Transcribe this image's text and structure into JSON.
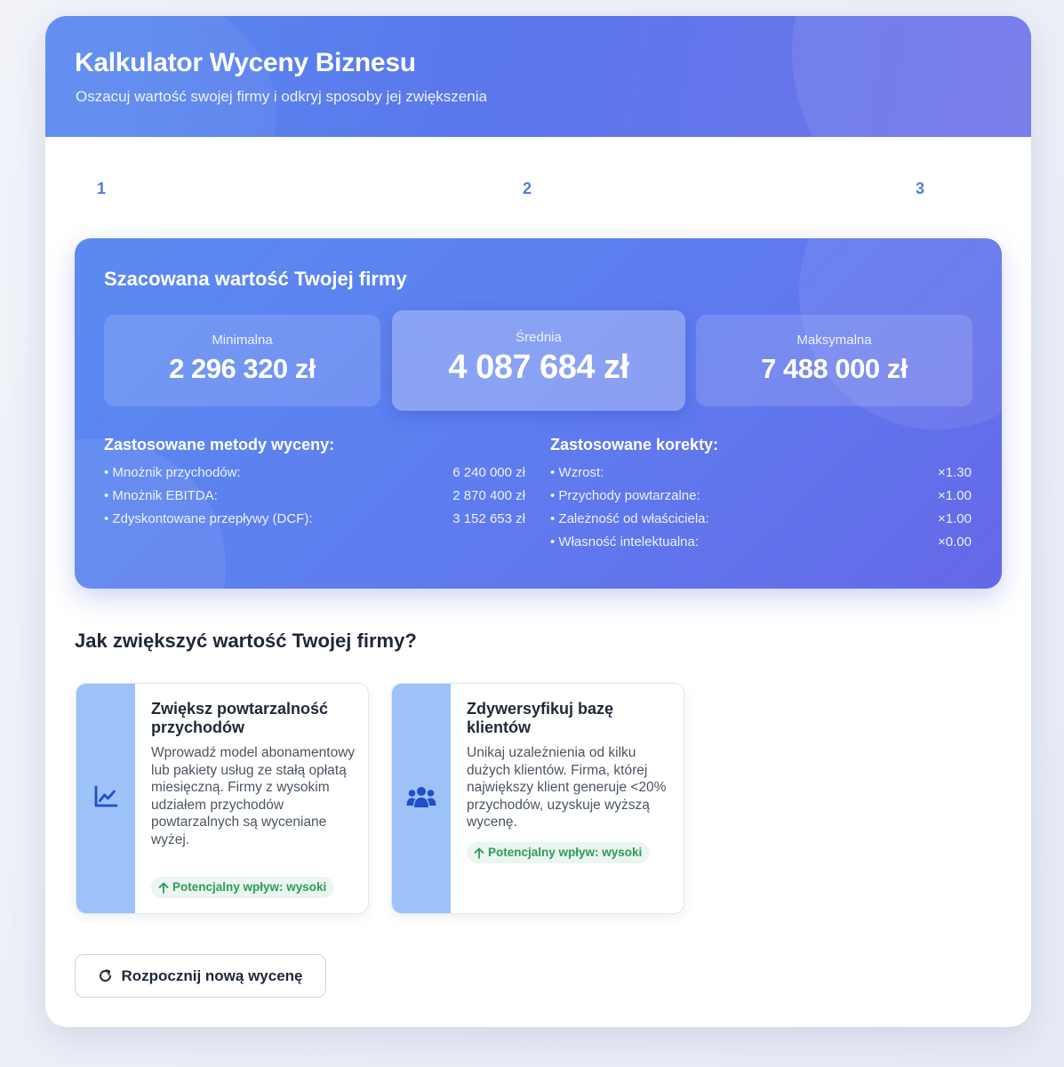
{
  "header": {
    "title": "Kalkulator Wyceny Biznesu",
    "subtitle": "Oszacuj wartość swojej firmy i odkryj sposoby jej zwiększenia"
  },
  "steps": [
    "1",
    "2",
    "3"
  ],
  "result": {
    "title": "Szacowana wartość Twojej firmy",
    "min": {
      "label": "Minimalna",
      "value": "2 296 320 zł"
    },
    "avg": {
      "label": "Średnia",
      "value": "4 087 684 zł"
    },
    "max": {
      "label": "Maksymalna",
      "value": "7 488 000 zł"
    },
    "methods": {
      "title": "Zastosowane metody wyceny:",
      "items": [
        {
          "label": "• Mnożnik przychodów:",
          "value": "6 240 000 zł"
        },
        {
          "label": "• Mnożnik EBITDA:",
          "value": "2 870 400 zł"
        },
        {
          "label": "• Zdyskontowane przepływy (DCF):",
          "value": "3 152 653 zł"
        }
      ]
    },
    "adjustments": {
      "title": "Zastosowane korekty:",
      "items": [
        {
          "label": "• Wzrost:",
          "value": "×1.30"
        },
        {
          "label": "• Przychody powtarzalne:",
          "value": "×1.00"
        },
        {
          "label": "• Zależność od właściciela:",
          "value": "×1.00"
        },
        {
          "label": "• Własność intelektualna:",
          "value": "×0.00"
        }
      ]
    }
  },
  "improve": {
    "title": "Jak zwiększyć wartość Twojej firmy?",
    "tips": [
      {
        "icon": "chart-line-icon",
        "title": "Zwiększ powtarzalność przychodów",
        "description": "Wprowadź model abonamentowy lub pakiety usług ze stałą opłatą miesięczną. Firmy z wysokim udziałem przychodów powtarzalnych są wyceniane wyżej.",
        "impact": "Potencjalny wpływ: wysoki"
      },
      {
        "icon": "users-icon",
        "title": "Zdywersyfikuj bazę klientów",
        "description": "Unikaj uzależnienia od kilku dużych klientów. Firma, której największy klient generuje <20% przychodów, uzyskuje wyższą wycenę.",
        "impact": "Potencjalny wpływ: wysoki"
      }
    ]
  },
  "restart_label": "Rozpocznij nową wycenę",
  "colors": {
    "accent": "#5a7ff0",
    "impact_green": "#2f9a5d",
    "tip_side": "#9cc2f7",
    "icon_blue": "#1f4fc9"
  }
}
